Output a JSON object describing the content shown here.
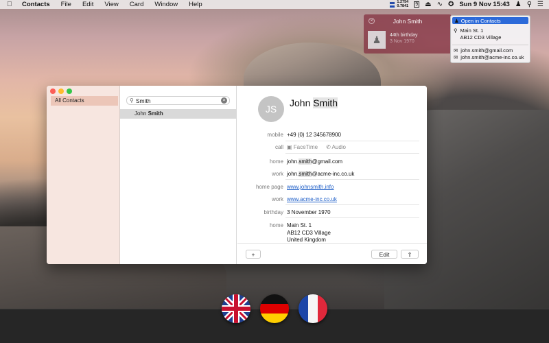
{
  "menubar": {
    "app_name": "Contacts",
    "menus": [
      "File",
      "Edit",
      "View",
      "Card",
      "Window",
      "Help"
    ],
    "rate_top": "1.2754",
    "rate_bottom": "0.7841",
    "datetime": "Sun 9 Nov  15:43",
    "calendar_day": "9"
  },
  "notification": {
    "title": "John Smith",
    "line1": "44th birthday",
    "line2": "3 Nov 1970"
  },
  "context_menu": {
    "highlight": "Open in Contacts",
    "address_line1": "Main St. 1",
    "address_line2": "AB12 CD3 Village",
    "email1": "john.smith@gmail.com",
    "email2": "john.smith@acme-inc.co.uk"
  },
  "sidebar": {
    "group": "All Contacts"
  },
  "search": {
    "value": "Smith"
  },
  "results": [
    {
      "first": "John",
      "last": "Smith"
    }
  ],
  "contact": {
    "initials": "JS",
    "first": "John",
    "last": "Smith",
    "mobile_label": "mobile",
    "mobile": "+49 (0) 12 345678900",
    "call_label": "call",
    "facetime": "FaceTime",
    "audio": "Audio",
    "home_email_label": "home",
    "home_email_pre": "john.",
    "home_email_hl": "smith",
    "home_email_post": "@gmail.com",
    "work_email_label": "work",
    "work_email_pre": "john.",
    "work_email_hl": "smith",
    "work_email_post": "@acme-inc.co.uk",
    "homepage_label": "home page",
    "homepage": "www.johnsmith.info",
    "work_url_label": "work",
    "work_url": "www.acme-inc.co.uk",
    "birthday_label": "birthday",
    "birthday": "3 November 1970",
    "address_label": "home",
    "address_line1": "Main St. 1",
    "address_line2": "AB12 CD3 Village",
    "address_line3": "United Kingdom"
  },
  "buttons": {
    "add": "+",
    "edit": "Edit",
    "share": "⇧"
  },
  "dock": {
    "items": [
      "uk-flag",
      "germany-flag",
      "france-flag"
    ]
  },
  "colors": {
    "sidebar_bg": "#f7e6e0",
    "selection": "#ecc6b8",
    "link": "#1f5fc8",
    "menu_highlight": "#2c6ad9",
    "notification_bg": "#873746"
  }
}
